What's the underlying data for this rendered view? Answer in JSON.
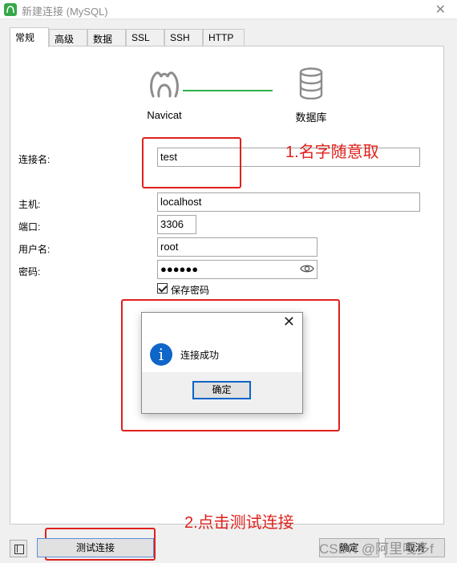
{
  "window": {
    "title": "新建连接 (MySQL)",
    "close_glyph": "✕"
  },
  "tabs": [
    {
      "label": "常规",
      "active": true
    },
    {
      "label": "高级"
    },
    {
      "label": "数据库"
    },
    {
      "label": "SSL"
    },
    {
      "label": "SSH"
    },
    {
      "label": "HTTP"
    }
  ],
  "graphic": {
    "left_caption": "Navicat",
    "right_caption": "数据库",
    "line_color": "#2fb24a"
  },
  "form": {
    "connection_name": {
      "label": "连接名:",
      "value": "test"
    },
    "host": {
      "label": "主机:",
      "value": "localhost"
    },
    "port": {
      "label": "端口:",
      "value": "3306"
    },
    "username": {
      "label": "用户名:",
      "value": "root"
    },
    "password": {
      "label": "密码:",
      "value": "●●●●●●"
    },
    "save_password": {
      "label": "保存密码",
      "checked": true
    }
  },
  "annotations": [
    {
      "text": "1.名字随意取",
      "color": "#e0201b"
    },
    {
      "text": "2.点击测试连接",
      "color": "#e0201b"
    }
  ],
  "dialog": {
    "close_glyph": "✕",
    "icon": "i",
    "message": "连接成功",
    "ok_label": "确定"
  },
  "footer": {
    "test_label": "测试连接",
    "ok_label": "确定",
    "cancel_label": "取消"
  },
  "watermark": "CSDN @阿里嘎多f"
}
